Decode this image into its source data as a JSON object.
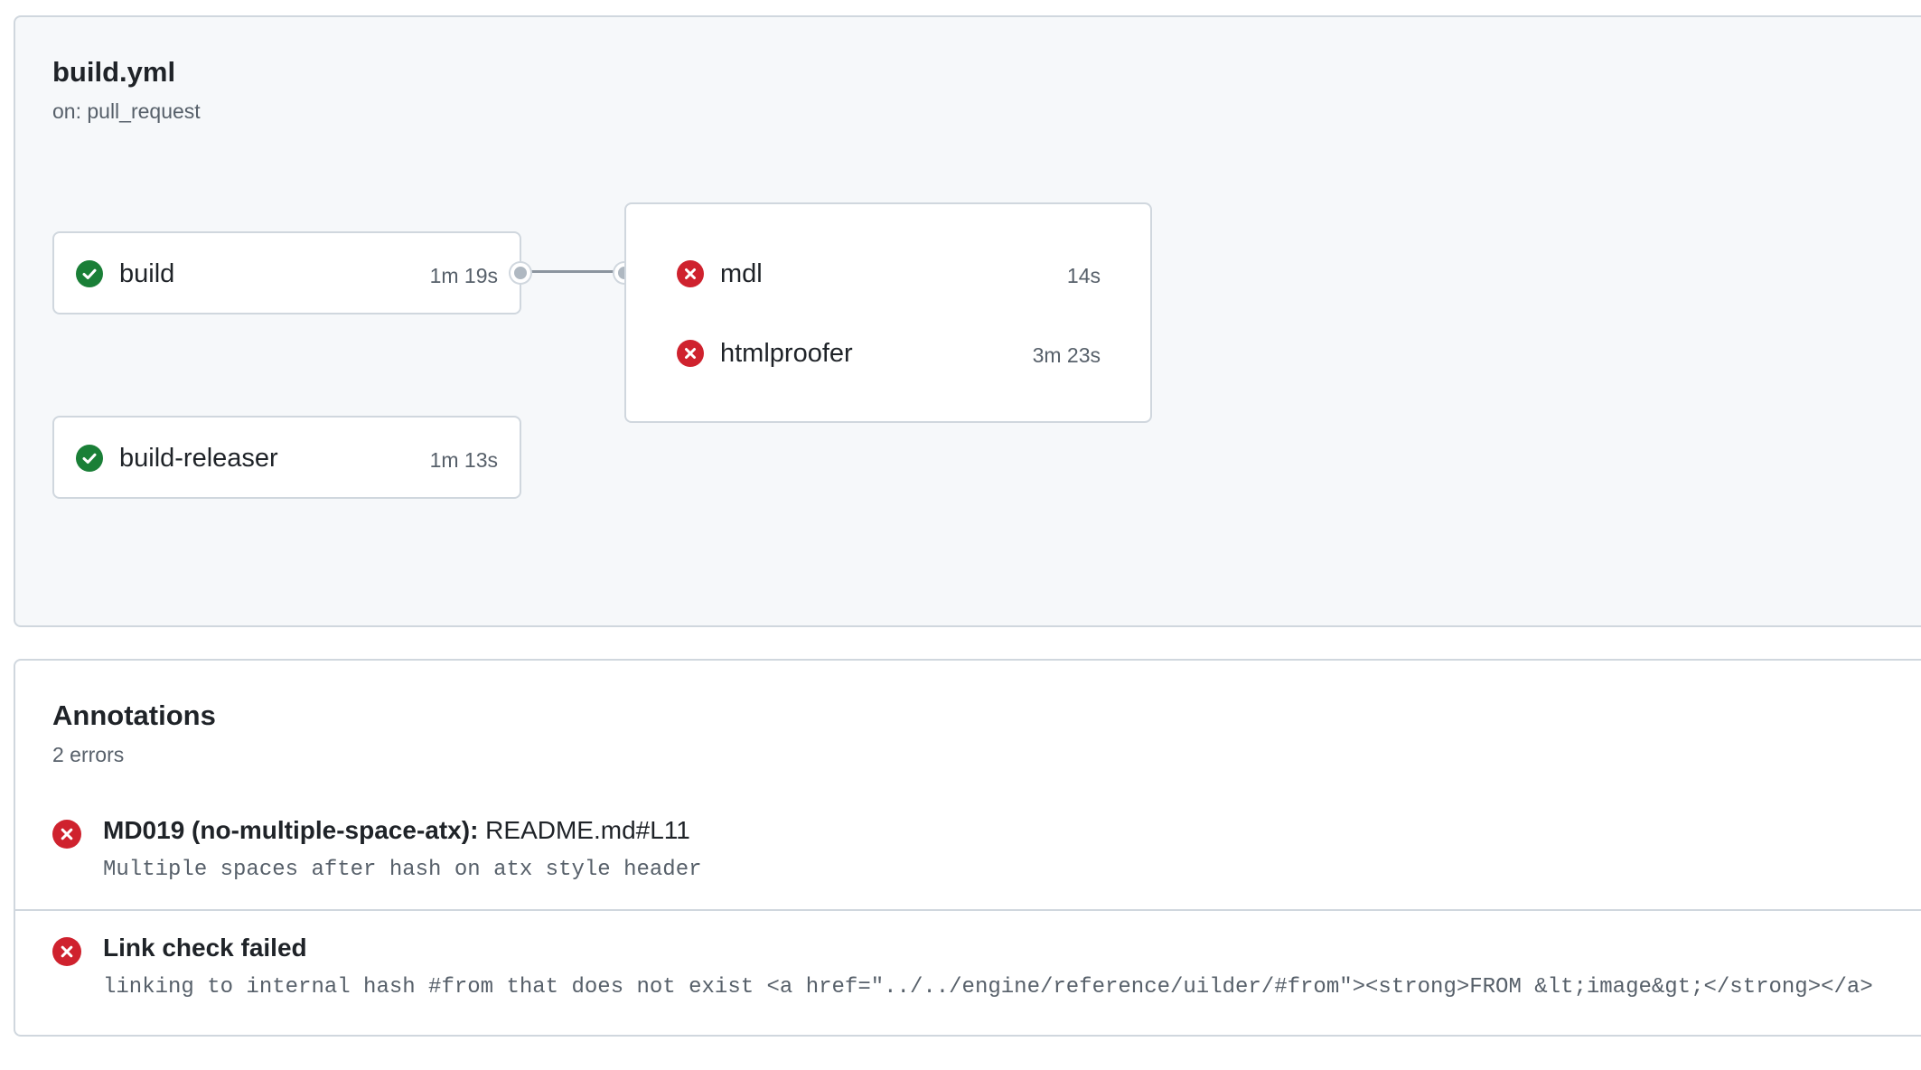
{
  "workflow": {
    "title": "build.yml",
    "trigger": "on: pull_request",
    "jobs": [
      {
        "name": "build",
        "duration": "1m 19s",
        "status": "success"
      },
      {
        "name": "build-releaser",
        "duration": "1m 13s",
        "status": "success"
      }
    ],
    "dependent_group": [
      {
        "name": "mdl",
        "duration": "14s",
        "status": "failure"
      },
      {
        "name": "htmlproofer",
        "duration": "3m 23s",
        "status": "failure"
      }
    ]
  },
  "annotations": {
    "title": "Annotations",
    "count": "2 errors",
    "items": [
      {
        "title_bold": "MD019 (no-multiple-space-atx):",
        "title_rest": " README.md#L11",
        "message": "Multiple spaces after hash on atx style header"
      },
      {
        "title_bold": "Link check failed",
        "title_rest": "",
        "message": "linking to internal hash #from that does not exist <a href=\"../../engine/reference/uilder/#from\"><strong>FROM &lt;image&gt;</strong></a>"
      }
    ]
  },
  "icons": {
    "success": "check-circle-icon",
    "failure": "x-circle-icon"
  },
  "colors": {
    "success": "#1a7f37",
    "failure": "#cf222e",
    "panel_bg": "#f6f8fa",
    "border": "#d0d7de"
  }
}
